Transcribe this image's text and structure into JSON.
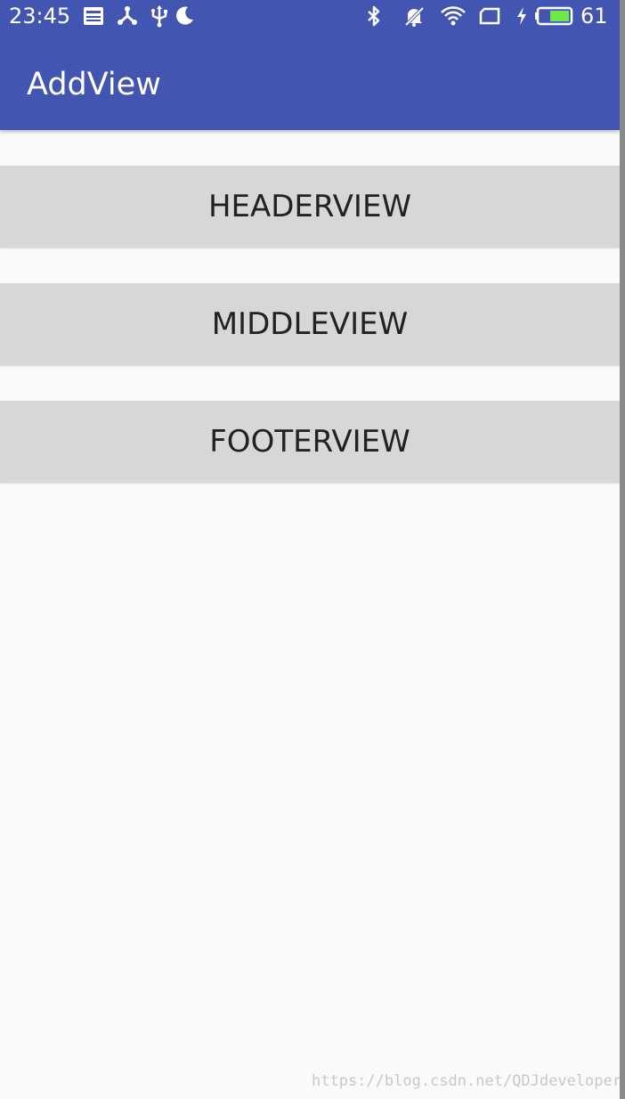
{
  "status_bar": {
    "time": "23:45",
    "battery_level": "61",
    "icons": [
      "news-icon",
      "share-icon",
      "usb-icon",
      "moon-icon",
      "bluetooth-icon",
      "notifications-off-icon",
      "wifi-icon",
      "screen-icon",
      "charging-icon",
      "battery-icon"
    ],
    "battery_fill_percent": 61,
    "battery_fill_color": "#6ee84a"
  },
  "app_bar": {
    "title": "AddView",
    "color": "#4255b1"
  },
  "buttons": {
    "header": "HEADERVIEW",
    "middle": "MIDDLEVIEW",
    "footer": "FOOTERVIEW"
  },
  "watermark": "https://blog.csdn.net/QDJdeveloper"
}
